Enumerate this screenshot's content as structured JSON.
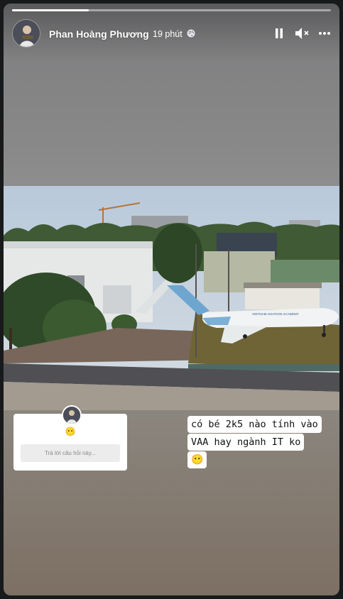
{
  "story": {
    "author_name": "Phan Hoàng Phương",
    "time": "19 phút",
    "privacy_icon": "globe-icon",
    "progress": 0.24
  },
  "controls": {
    "pause": "pause-icon",
    "mute": "speaker-muted-icon",
    "more": "more-icon"
  },
  "question": {
    "emoji": "😶",
    "reply_placeholder": "Trả lời câu hỏi này..."
  },
  "caption": {
    "line1": "có bé 2k5 nào tính vào",
    "line2": "VAA hay ngành IT ko",
    "emoji": "😶"
  },
  "photo": {
    "plane_text": "VIETNAM AVIATION ACADEMY"
  }
}
